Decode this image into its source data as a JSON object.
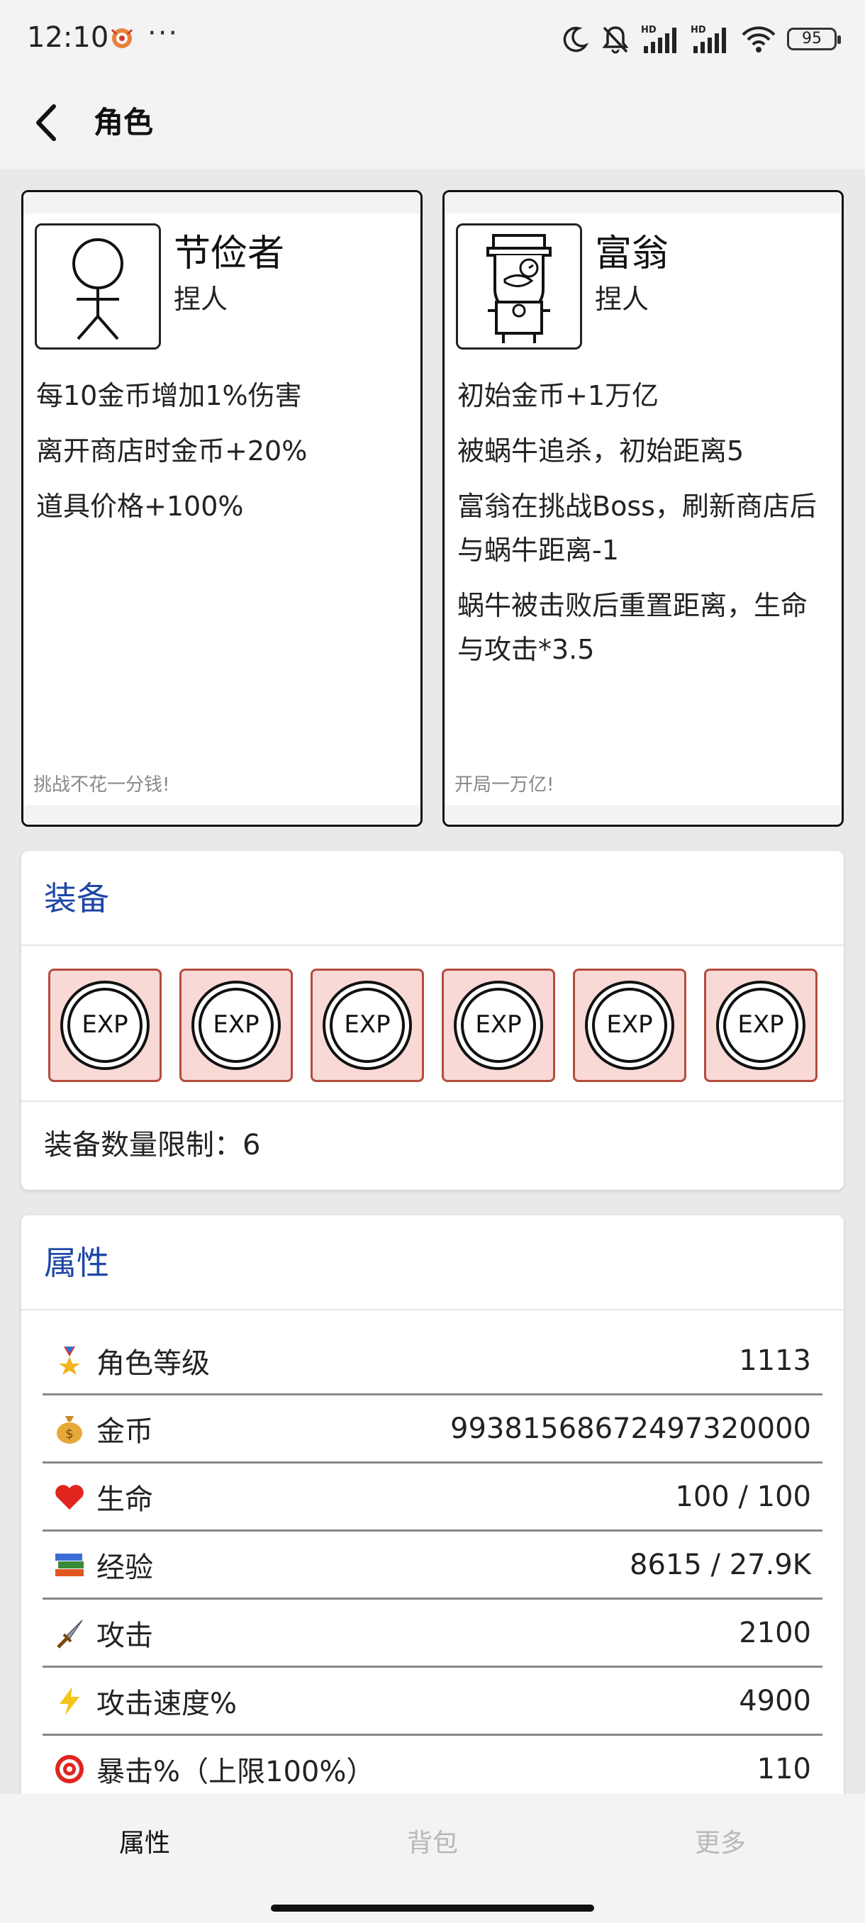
{
  "status_bar": {
    "time": "12:10",
    "dots": "···",
    "battery": "95"
  },
  "header": {
    "title": "角色"
  },
  "characters": [
    {
      "name": "节俭者",
      "type": "捏人",
      "desc": [
        "每10金币增加1%伤害",
        "离开商店时金币+20%",
        "道具价格+100%"
      ],
      "slogan": "挑战不花一分钱!"
    },
    {
      "name": "富翁",
      "type": "捏人",
      "desc": [
        "初始金币+1万亿",
        "被蜗牛追杀，初始距离5",
        "富翁在挑战Boss，刷新商店后与蜗牛距离-1",
        "蜗牛被击败后重置距离，生命与攻击*3.5"
      ],
      "slogan": "开局一万亿!"
    }
  ],
  "equipment": {
    "title": "装备",
    "slots": [
      "EXP",
      "EXP",
      "EXP",
      "EXP",
      "EXP",
      "EXP"
    ],
    "limit_text": "装备数量限制：6"
  },
  "attributes": {
    "title": "属性",
    "rows": [
      {
        "icon": "medal-icon",
        "label": "角色等级",
        "value": "1113"
      },
      {
        "icon": "money-bag-icon",
        "label": "金币",
        "value": "99381568672497320000"
      },
      {
        "icon": "heart-icon",
        "label": "生命",
        "value": "100 / 100"
      },
      {
        "icon": "books-icon",
        "label": "经验",
        "value": "8615 / 27.9K"
      },
      {
        "icon": "dagger-icon",
        "label": "攻击",
        "value": "2100"
      },
      {
        "icon": "lightning-icon",
        "label": "攻击速度%",
        "value": "4900"
      },
      {
        "icon": "target-icon",
        "label": "暴击%（上限100%）",
        "value": "110"
      }
    ]
  },
  "bottom_nav": {
    "tabs": [
      "属性",
      "背包",
      "更多"
    ]
  },
  "colors": {
    "accent": "#1f47a8",
    "equip_bg": "#f9d9d6",
    "equip_border": "#b44d3c"
  }
}
